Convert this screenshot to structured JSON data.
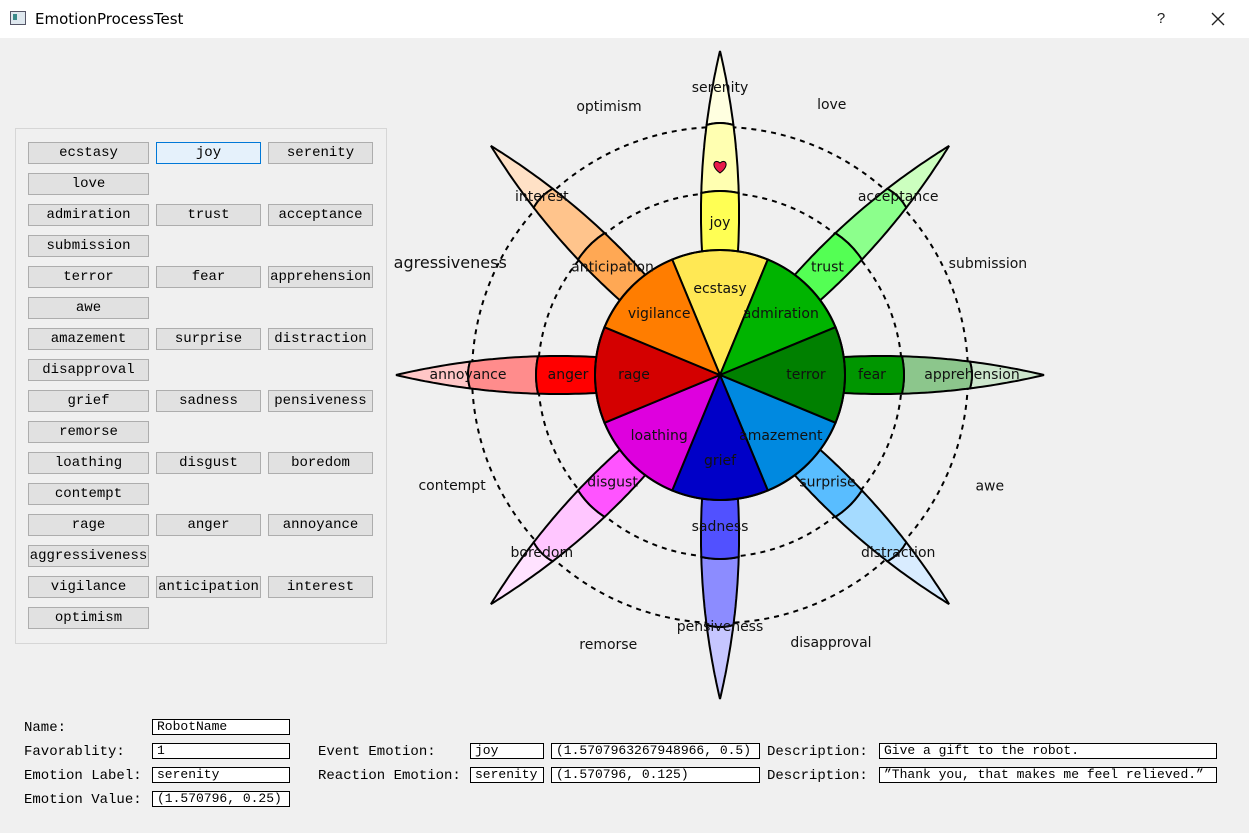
{
  "window": {
    "title": "EmotionProcessTest",
    "help_symbol": "?"
  },
  "buttons": {
    "ecstasy": "ecstasy",
    "joy": "joy",
    "serenity": "serenity",
    "love": "love",
    "admiration": "admiration",
    "trust": "trust",
    "acceptance": "acceptance",
    "submission": "submission",
    "terror": "terror",
    "fear": "fear",
    "apprehension": "apprehension",
    "awe": "awe",
    "amazement": "amazement",
    "surprise": "surprise",
    "distraction": "distraction",
    "disapproval": "disapproval",
    "grief": "grief",
    "sadness": "sadness",
    "pensiveness": "pensiveness",
    "remorse": "remorse",
    "loathing": "loathing",
    "disgust": "disgust",
    "boredom": "boredom",
    "contempt": "contempt",
    "rage": "rage",
    "anger": "anger",
    "annoyance": "annoyance",
    "aggressiveness": "aggressiveness",
    "vigilance": "vigilance",
    "anticipation": "anticipation",
    "interest": "interest",
    "optimism": "optimism",
    "active": "joy"
  },
  "wheel": {
    "petals": [
      {
        "outer": "serenity",
        "middle": "joy",
        "inner": "ecstasy",
        "colors": [
          "#ffffe0",
          "#ffffb1",
          "#ffff54",
          "#ffe854"
        ]
      },
      {
        "outer": "acceptance",
        "middle": "trust",
        "inner": "admiration",
        "colors": [
          "#ccffbf",
          "#8cff8c",
          "#54ff54",
          "#00b400"
        ]
      },
      {
        "outer": "apprehension",
        "middle": "fear",
        "inner": "terror",
        "colors": [
          "#cce6cc",
          "#8cc68c",
          "#009600",
          "#008000"
        ]
      },
      {
        "outer": "distraction",
        "middle": "surprise",
        "inner": "amazement",
        "colors": [
          "#d9ecff",
          "#a5dbff",
          "#59bdff",
          "#0089e0"
        ]
      },
      {
        "outer": "pensiveness",
        "middle": "sadness",
        "inner": "grief",
        "colors": [
          "#c6c6ff",
          "#8c8cff",
          "#5151ff",
          "#0000c8"
        ]
      },
      {
        "outer": "boredom",
        "middle": "disgust",
        "inner": "loathing",
        "colors": [
          "#ffe2ff",
          "#ffc6ff",
          "#ff54ff",
          "#de00de"
        ]
      },
      {
        "outer": "annoyance",
        "middle": "anger",
        "inner": "rage",
        "colors": [
          "#ffc6c6",
          "#ff8c8c",
          "#ff0000",
          "#d40000"
        ]
      },
      {
        "outer": "interest",
        "middle": "anticipation",
        "inner": "vigilance",
        "colors": [
          "#ffe1c6",
          "#ffc48c",
          "#ffa854",
          "#ff7d00"
        ]
      }
    ],
    "dyads": [
      "love",
      "submission",
      "awe",
      "disapproval",
      "remorse",
      "contempt",
      "agressiveness",
      "optimism"
    ],
    "marker": {
      "emotion": "serenity",
      "color": "#e8194a"
    }
  },
  "info": {
    "name_label": "Name:",
    "name_value": "RobotName",
    "favorability_label": "Favorablity:",
    "favorability_value": "1",
    "emotion_label_label": "Emotion Label:",
    "emotion_label_value": "serenity",
    "emotion_value_label": "Emotion Value:",
    "emotion_value_value": "(1.570796, 0.25)",
    "event_emotion_label": "Event Emotion:",
    "event_emotion_value": "joy",
    "event_emotion_coords": "(1.5707963267948966, 0.5)",
    "event_description_label": "Description:",
    "event_description_value": "Give a gift to the robot.",
    "reaction_emotion_label": "Reaction Emotion:",
    "reaction_emotion_value": "serenity",
    "reaction_emotion_coords": "(1.570796, 0.125)",
    "reaction_description_label": "Description:",
    "reaction_description_value": "”Thank you, that makes me feel relieved.”"
  }
}
